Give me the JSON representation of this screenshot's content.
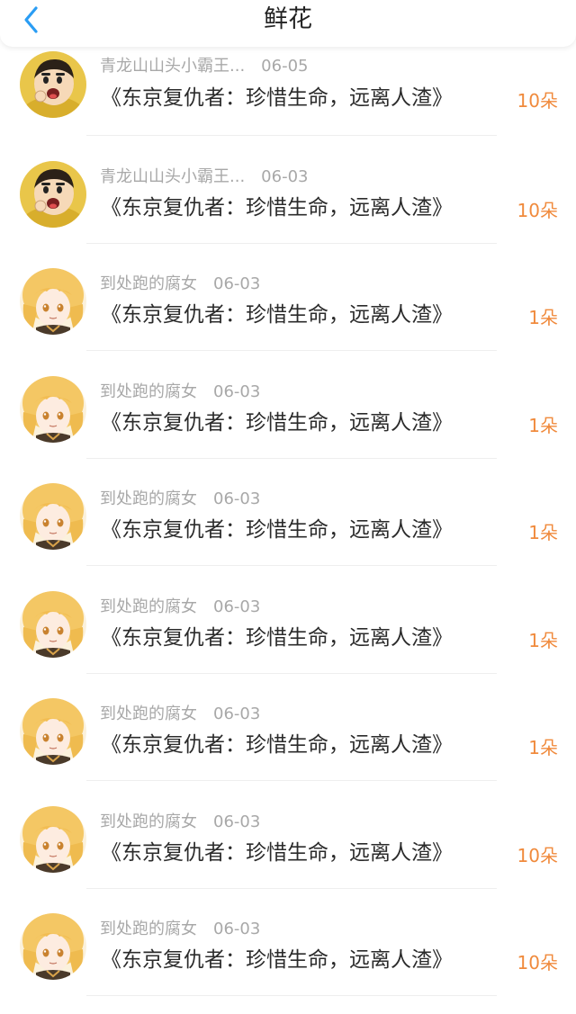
{
  "header": {
    "title": "鲜花",
    "back_icon": "chevron-left-icon",
    "accent": "#2a9df4"
  },
  "colors": {
    "count": "#f08a3c",
    "meta": "#a8a8a8",
    "title": "#2b2b2b"
  },
  "items": [
    {
      "user": "青龙山山头小霸王...",
      "date": "06-05",
      "book": "《东京复仇者：珍惜生命，远离人渣》",
      "count": "10朵",
      "avatar": "shinchan-avatar-icon"
    },
    {
      "user": "青龙山山头小霸王...",
      "date": "06-03",
      "book": "《东京复仇者：珍惜生命，远离人渣》",
      "count": "10朵",
      "avatar": "shinchan-avatar-icon"
    },
    {
      "user": "到处跑的腐女",
      "date": "06-03",
      "book": "《东京复仇者：珍惜生命，远离人渣》",
      "count": "1朵",
      "avatar": "anime-girl-avatar-icon"
    },
    {
      "user": "到处跑的腐女",
      "date": "06-03",
      "book": "《东京复仇者：珍惜生命，远离人渣》",
      "count": "1朵",
      "avatar": "anime-girl-avatar-icon"
    },
    {
      "user": "到处跑的腐女",
      "date": "06-03",
      "book": "《东京复仇者：珍惜生命，远离人渣》",
      "count": "1朵",
      "avatar": "anime-girl-avatar-icon"
    },
    {
      "user": "到处跑的腐女",
      "date": "06-03",
      "book": "《东京复仇者：珍惜生命，远离人渣》",
      "count": "1朵",
      "avatar": "anime-girl-avatar-icon"
    },
    {
      "user": "到处跑的腐女",
      "date": "06-03",
      "book": "《东京复仇者：珍惜生命，远离人渣》",
      "count": "1朵",
      "avatar": "anime-girl-avatar-icon"
    },
    {
      "user": "到处跑的腐女",
      "date": "06-03",
      "book": "《东京复仇者：珍惜生命，远离人渣》",
      "count": "10朵",
      "avatar": "anime-girl-avatar-icon"
    },
    {
      "user": "到处跑的腐女",
      "date": "06-03",
      "book": "《东京复仇者：珍惜生命，远离人渣》",
      "count": "10朵",
      "avatar": "anime-girl-avatar-icon"
    }
  ]
}
